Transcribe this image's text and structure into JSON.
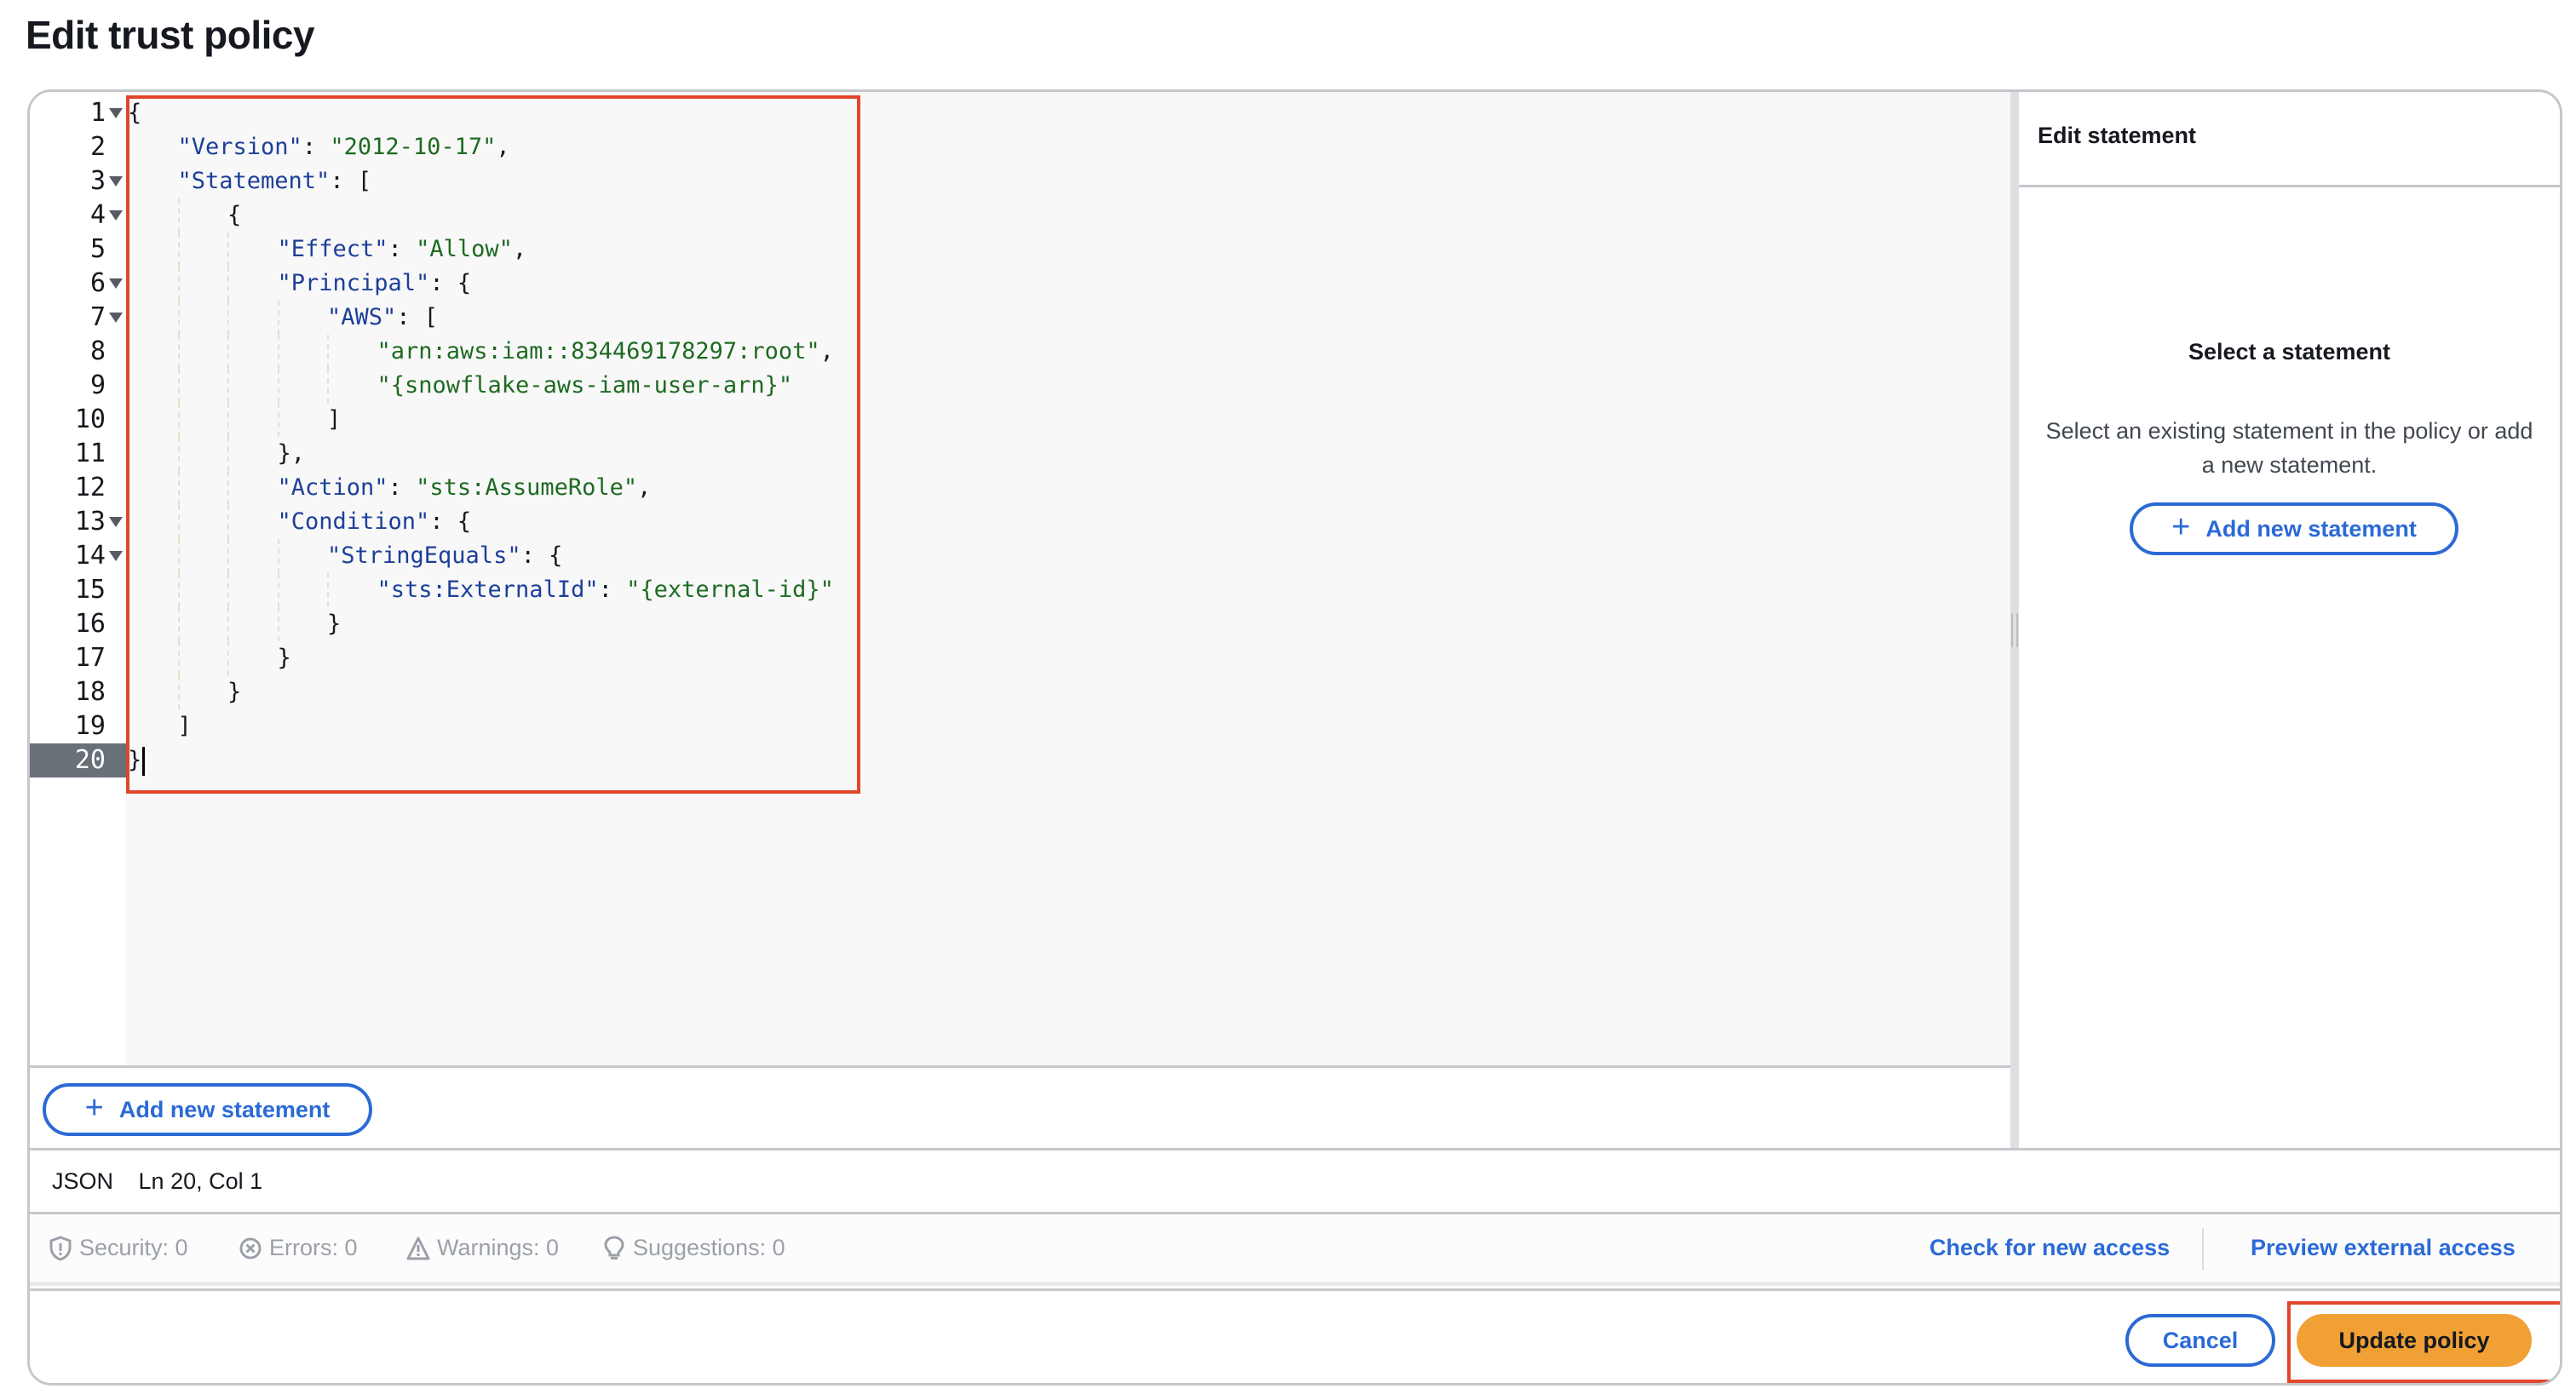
{
  "page": {
    "title": "Edit trust policy"
  },
  "editor": {
    "lines": [
      {
        "no": "1",
        "fold": true,
        "indent": 0,
        "tokens": [
          {
            "t": "p",
            "v": "{"
          }
        ]
      },
      {
        "no": "2",
        "fold": false,
        "indent": 1,
        "tokens": [
          {
            "t": "k",
            "v": "\"Version\""
          },
          {
            "t": "p",
            "v": ": "
          },
          {
            "t": "s",
            "v": "\"2012-10-17\""
          },
          {
            "t": "p",
            "v": ","
          }
        ]
      },
      {
        "no": "3",
        "fold": true,
        "indent": 1,
        "tokens": [
          {
            "t": "k",
            "v": "\"Statement\""
          },
          {
            "t": "p",
            "v": ": ["
          }
        ]
      },
      {
        "no": "4",
        "fold": true,
        "indent": 2,
        "tokens": [
          {
            "t": "p",
            "v": "{"
          }
        ]
      },
      {
        "no": "5",
        "fold": false,
        "indent": 3,
        "tokens": [
          {
            "t": "k",
            "v": "\"Effect\""
          },
          {
            "t": "p",
            "v": ": "
          },
          {
            "t": "s",
            "v": "\"Allow\""
          },
          {
            "t": "p",
            "v": ","
          }
        ]
      },
      {
        "no": "6",
        "fold": true,
        "indent": 3,
        "tokens": [
          {
            "t": "k",
            "v": "\"Principal\""
          },
          {
            "t": "p",
            "v": ": {"
          }
        ]
      },
      {
        "no": "7",
        "fold": true,
        "indent": 4,
        "tokens": [
          {
            "t": "k",
            "v": "\"AWS\""
          },
          {
            "t": "p",
            "v": ": ["
          }
        ]
      },
      {
        "no": "8",
        "fold": false,
        "indent": 5,
        "tokens": [
          {
            "t": "s",
            "v": "\"arn:aws:iam::834469178297:root\""
          },
          {
            "t": "p",
            "v": ","
          }
        ]
      },
      {
        "no": "9",
        "fold": false,
        "indent": 5,
        "tokens": [
          {
            "t": "s",
            "v": "\"{snowflake-aws-iam-user-arn}\""
          }
        ]
      },
      {
        "no": "10",
        "fold": false,
        "indent": 4,
        "tokens": [
          {
            "t": "p",
            "v": "]"
          }
        ]
      },
      {
        "no": "11",
        "fold": false,
        "indent": 3,
        "tokens": [
          {
            "t": "p",
            "v": "},"
          }
        ]
      },
      {
        "no": "12",
        "fold": false,
        "indent": 3,
        "tokens": [
          {
            "t": "k",
            "v": "\"Action\""
          },
          {
            "t": "p",
            "v": ": "
          },
          {
            "t": "s",
            "v": "\"sts:AssumeRole\""
          },
          {
            "t": "p",
            "v": ","
          }
        ]
      },
      {
        "no": "13",
        "fold": true,
        "indent": 3,
        "tokens": [
          {
            "t": "k",
            "v": "\"Condition\""
          },
          {
            "t": "p",
            "v": ": {"
          }
        ]
      },
      {
        "no": "14",
        "fold": true,
        "indent": 4,
        "tokens": [
          {
            "t": "k",
            "v": "\"StringEquals\""
          },
          {
            "t": "p",
            "v": ": {"
          }
        ]
      },
      {
        "no": "15",
        "fold": false,
        "indent": 5,
        "tokens": [
          {
            "t": "k",
            "v": "\"sts:ExternalId\""
          },
          {
            "t": "p",
            "v": ": "
          },
          {
            "t": "s",
            "v": "\"{external-id}\""
          }
        ]
      },
      {
        "no": "16",
        "fold": false,
        "indent": 4,
        "tokens": [
          {
            "t": "p",
            "v": "}"
          }
        ]
      },
      {
        "no": "17",
        "fold": false,
        "indent": 3,
        "tokens": [
          {
            "t": "p",
            "v": "}"
          }
        ]
      },
      {
        "no": "18",
        "fold": false,
        "indent": 2,
        "tokens": [
          {
            "t": "p",
            "v": "}"
          }
        ]
      },
      {
        "no": "19",
        "fold": false,
        "indent": 1,
        "tokens": [
          {
            "t": "p",
            "v": "]"
          }
        ]
      },
      {
        "no": "20",
        "fold": false,
        "indent": 0,
        "active": true,
        "tokens": [
          {
            "t": "p",
            "v": "}"
          }
        ]
      }
    ],
    "add_statement_label": "Add new statement"
  },
  "side_panel": {
    "header": "Edit statement",
    "empty_title": "Select a statement",
    "empty_description": "Select an existing statement in the policy or add a new statement.",
    "add_statement_label": "Add new statement"
  },
  "status": {
    "language": "JSON",
    "position": "Ln 20, Col 1"
  },
  "analyzer": {
    "security": "Security: 0",
    "errors": "Errors: 0",
    "warnings": "Warnings: 0",
    "suggestions": "Suggestions: 0",
    "check_access_label": "Check for new access",
    "preview_access_label": "Preview external access"
  },
  "footer": {
    "cancel_label": "Cancel",
    "update_label": "Update policy"
  },
  "colors": {
    "accent_blue": "#2b6ad6",
    "primary_orange": "#f0a034",
    "annotation_red": "#e0462a",
    "json_key": "#1d3f99",
    "json_string": "#1f6a22"
  }
}
